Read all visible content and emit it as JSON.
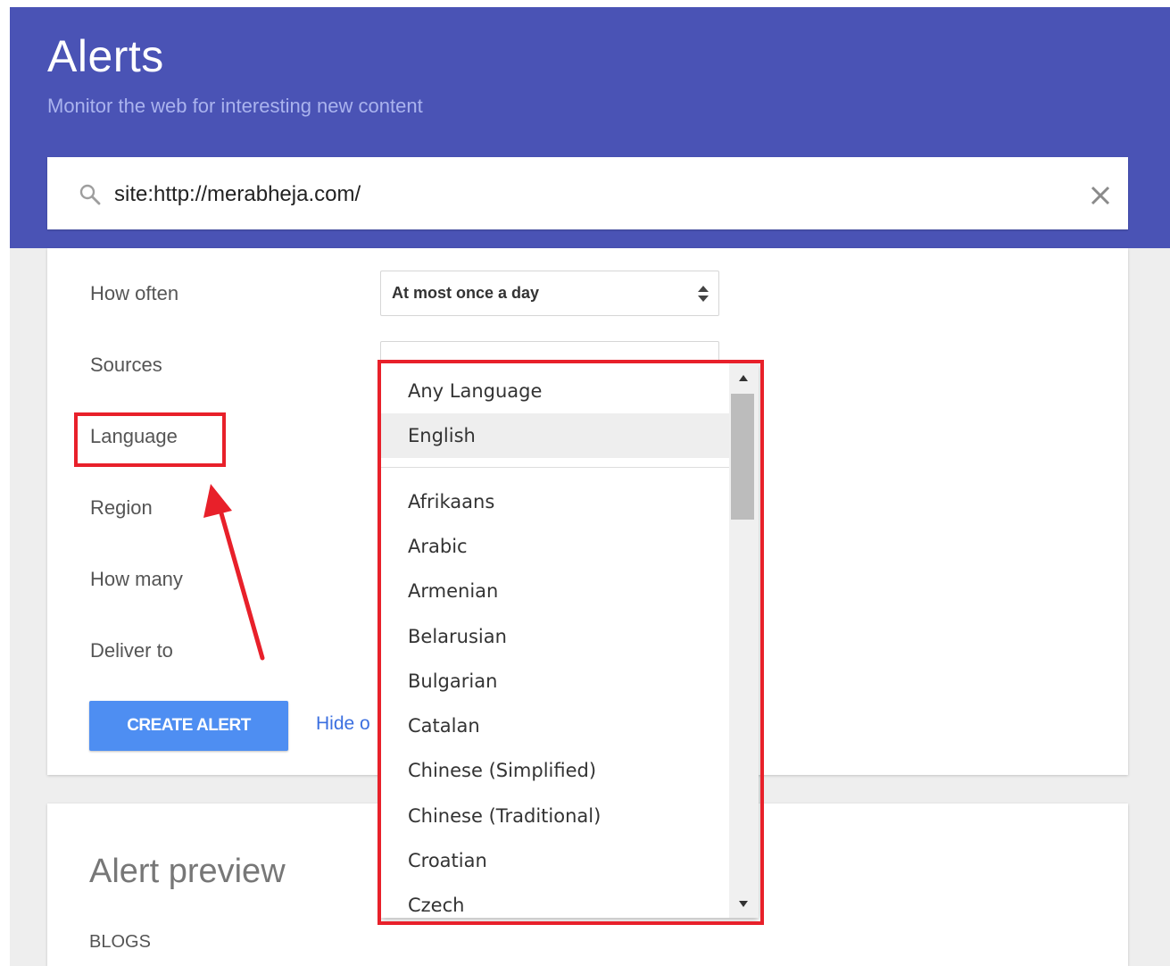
{
  "header": {
    "title": "Alerts",
    "subtitle": "Monitor the web for interesting new content"
  },
  "search": {
    "value": "site:http://merabheja.com/"
  },
  "options": {
    "how_often": {
      "label": "How often",
      "value": "At most once a day"
    },
    "sources": {
      "label": "Sources"
    },
    "language": {
      "label": "Language"
    },
    "region": {
      "label": "Region"
    },
    "how_many": {
      "label": "How many"
    },
    "deliver_to": {
      "label": "Deliver to"
    }
  },
  "actions": {
    "create_alert": "CREATE ALERT",
    "hide_options": "Hide o"
  },
  "preview": {
    "title": "Alert preview",
    "section": "BLOGS"
  },
  "language_dropdown": {
    "items": [
      "Any Language",
      "English",
      "Afrikaans",
      "Arabic",
      "Armenian",
      "Belarusian",
      "Bulgarian",
      "Catalan",
      "Chinese (Simplified)",
      "Chinese (Traditional)",
      "Croatian",
      "Czech"
    ],
    "selected": "English"
  },
  "colors": {
    "header": "#4a53b5",
    "primary_button": "#4e8ef2",
    "highlight": "#e8202a",
    "link": "#3b6fe0"
  }
}
